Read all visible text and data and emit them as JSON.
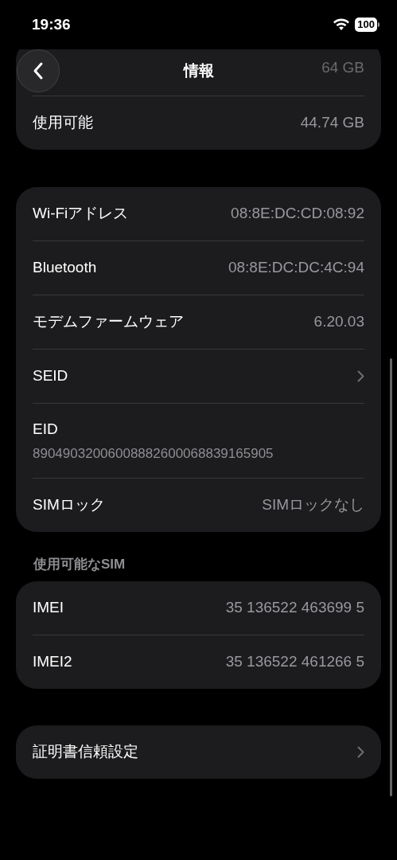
{
  "status_bar": {
    "time": "19:36",
    "battery": "100"
  },
  "nav": {
    "title": "情報"
  },
  "groups": [
    {
      "rows": [
        {
          "kind": "faded",
          "value": "64 GB"
        },
        {
          "kind": "value",
          "label": "使用可能",
          "value": "44.74 GB"
        }
      ]
    },
    {
      "rows": [
        {
          "kind": "value",
          "label": "Wi-Fiアドレス",
          "value": "08:8E:DC:CD:08:92"
        },
        {
          "kind": "value",
          "label": "Bluetooth",
          "value": "08:8E:DC:DC:4C:94"
        },
        {
          "kind": "value",
          "label": "モデムファームウェア",
          "value": "6.20.03"
        },
        {
          "kind": "chevron",
          "label": "SEID"
        },
        {
          "kind": "stacked",
          "label": "EID",
          "value": "89049032006008882600068839165905"
        },
        {
          "kind": "value",
          "label": "SIMロック",
          "value": "SIMロックなし"
        }
      ]
    },
    {
      "header": "使用可能なSIM",
      "rows": [
        {
          "kind": "value",
          "label": "IMEI",
          "value": "35 136522 463699 5"
        },
        {
          "kind": "value",
          "label": "IMEI2",
          "value": "35 136522 461266 5"
        }
      ]
    },
    {
      "rows": [
        {
          "kind": "chevron",
          "label": "証明書信頼設定"
        }
      ]
    }
  ]
}
